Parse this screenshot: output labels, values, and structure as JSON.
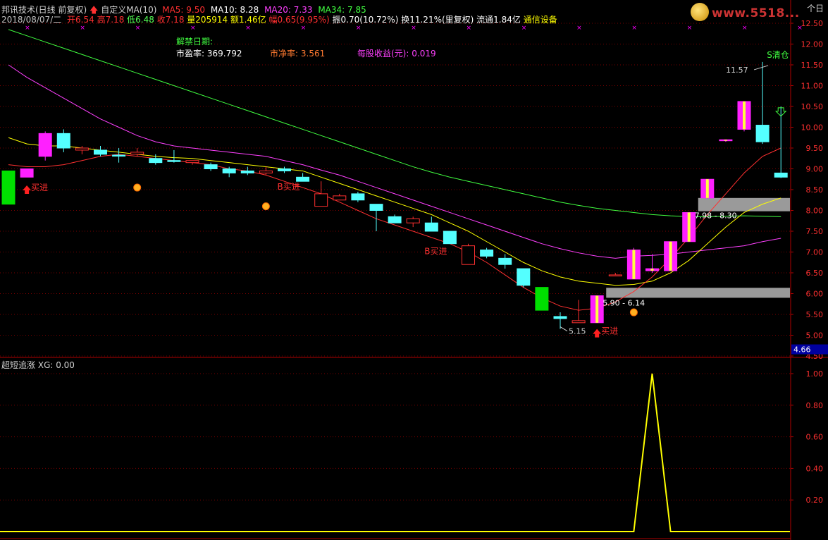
{
  "header": {
    "title": "邦讯技术(日线 前复权)",
    "custom_label": "自定义MA(10)",
    "ma5": "MA5: 9.50",
    "ma10": "MA10: 8.28",
    "ma20": "MA20: 7.33",
    "ma34": "MA34: 7.85",
    "date": "2018/08/07/二",
    "open": "开6.54",
    "high": "高7.18",
    "low": "低6.48",
    "close": "收7.18",
    "volume": "量205914",
    "amount": "额1.46亿",
    "change": "幅0.65(9.95%)",
    "amplitude": "振0.70(10.72%)",
    "turnover": "换11.21%(里复权)",
    "float_cap": "流通1.84亿",
    "industry": "通信设备"
  },
  "info": {
    "unlock": "解禁日期:",
    "pe_label": "市盈率:",
    "pe_value": "369.792",
    "pb_label": "市净率:",
    "pb_value": "3.561",
    "eps_label": "每股收益(元):",
    "eps_value": "0.019"
  },
  "logo": {
    "text": "www.5518...",
    "corner": "个日"
  },
  "indicator": {
    "title": "超短追涨",
    "xg": "XG: 0.00"
  },
  "colors": {
    "bg": "#000000",
    "grid": "#7a0000",
    "up": "#ff3030",
    "down": "#54ffff",
    "ma5": "#ffffff",
    "ma10": "#ff3030",
    "ma20": "#ff40ff",
    "ma34": "#40ff40",
    "yellow": "#ffff00",
    "signal": "#ff00ff"
  },
  "chart_data": {
    "type": "candlestick",
    "y_axis": {
      "min": 4.5,
      "max": 12.5,
      "ticks": [
        4.5,
        5.0,
        5.5,
        6.0,
        6.5,
        7.0,
        7.5,
        8.0,
        8.5,
        9.0,
        9.5,
        10.0,
        10.5,
        11.0,
        11.5,
        12.0,
        12.5
      ]
    },
    "last_price_label": "4.66",
    "candles": [
      {
        "o": 8.15,
        "h": 8.95,
        "l": 8.15,
        "c": 8.95,
        "color": "green"
      },
      {
        "o": 8.8,
        "h": 9.0,
        "l": 8.8,
        "c": 9.0,
        "color": "magenta"
      },
      {
        "o": 9.3,
        "h": 9.9,
        "l": 9.2,
        "c": 9.85,
        "color": "magenta"
      },
      {
        "o": 9.85,
        "h": 9.95,
        "l": 9.4,
        "c": 9.5,
        "color": "cyan"
      },
      {
        "o": 9.45,
        "h": 9.55,
        "l": 9.35,
        "c": 9.5,
        "color": "up"
      },
      {
        "o": 9.45,
        "h": 9.55,
        "l": 9.3,
        "c": 9.35,
        "color": "cyan"
      },
      {
        "o": 9.32,
        "h": 9.5,
        "l": 9.15,
        "c": 9.33,
        "color": "cyan"
      },
      {
        "o": 9.35,
        "h": 9.5,
        "l": 9.3,
        "c": 9.4,
        "color": "up"
      },
      {
        "o": 9.25,
        "h": 9.35,
        "l": 9.1,
        "c": 9.15,
        "color": "cyan"
      },
      {
        "o": 9.2,
        "h": 9.45,
        "l": 9.15,
        "c": 9.2,
        "color": "cyan"
      },
      {
        "o": 9.15,
        "h": 9.2,
        "l": 9.1,
        "c": 9.2,
        "color": "up"
      },
      {
        "o": 9.1,
        "h": 9.15,
        "l": 8.95,
        "c": 9.0,
        "color": "cyan"
      },
      {
        "o": 9.0,
        "h": 9.05,
        "l": 8.8,
        "c": 8.9,
        "color": "cyan"
      },
      {
        "o": 8.95,
        "h": 9.05,
        "l": 8.85,
        "c": 8.9,
        "color": "cyan"
      },
      {
        "o": 8.9,
        "h": 9.05,
        "l": 8.85,
        "c": 8.95,
        "color": "up"
      },
      {
        "o": 9.0,
        "h": 9.05,
        "l": 8.9,
        "c": 8.95,
        "color": "cyan"
      },
      {
        "o": 8.8,
        "h": 8.9,
        "l": 8.7,
        "c": 8.7,
        "color": "cyan"
      },
      {
        "o": 8.1,
        "h": 8.7,
        "l": 8.1,
        "c": 8.4,
        "color": "up"
      },
      {
        "o": 8.25,
        "h": 8.4,
        "l": 8.25,
        "c": 8.35,
        "color": "up"
      },
      {
        "o": 8.4,
        "h": 8.45,
        "l": 8.2,
        "c": 8.25,
        "color": "cyan"
      },
      {
        "o": 8.15,
        "h": 8.15,
        "l": 7.5,
        "c": 8.0,
        "color": "cyan"
      },
      {
        "o": 7.85,
        "h": 7.9,
        "l": 7.7,
        "c": 7.7,
        "color": "cyan"
      },
      {
        "o": 7.7,
        "h": 7.85,
        "l": 7.6,
        "c": 7.8,
        "color": "up"
      },
      {
        "o": 7.7,
        "h": 7.85,
        "l": 7.5,
        "c": 7.5,
        "color": "cyan"
      },
      {
        "o": 7.5,
        "h": 7.5,
        "l": 7.2,
        "c": 7.2,
        "color": "cyan"
      },
      {
        "o": 6.7,
        "h": 7.2,
        "l": 6.7,
        "c": 7.15,
        "color": "up"
      },
      {
        "o": 7.05,
        "h": 7.1,
        "l": 6.85,
        "c": 6.9,
        "color": "cyan"
      },
      {
        "o": 6.85,
        "h": 6.95,
        "l": 6.6,
        "c": 6.7,
        "color": "cyan"
      },
      {
        "o": 6.6,
        "h": 6.6,
        "l": 6.15,
        "c": 6.2,
        "color": "cyan"
      },
      {
        "o": 5.6,
        "h": 6.15,
        "l": 5.6,
        "c": 6.15,
        "color": "green"
      },
      {
        "o": 5.45,
        "h": 5.55,
        "l": 5.15,
        "c": 5.4,
        "color": "cyan"
      },
      {
        "o": 5.3,
        "h": 5.85,
        "l": 5.3,
        "c": 5.35,
        "color": "up"
      },
      {
        "o": 5.3,
        "h": 5.95,
        "l": 5.3,
        "c": 5.95,
        "color": "magenta"
      },
      {
        "o": 6.45,
        "h": 6.5,
        "l": 6.45,
        "c": 6.45,
        "color": "up"
      },
      {
        "o": 6.35,
        "h": 7.1,
        "l": 6.35,
        "c": 7.05,
        "color": "magenta"
      },
      {
        "o": 6.55,
        "h": 6.95,
        "l": 6.5,
        "c": 6.6,
        "color": "magenta"
      },
      {
        "o": 6.55,
        "h": 7.25,
        "l": 6.55,
        "c": 7.25,
        "color": "magenta"
      },
      {
        "o": 7.25,
        "h": 7.95,
        "l": 7.25,
        "c": 7.95,
        "color": "magenta"
      },
      {
        "o": 8.3,
        "h": 8.75,
        "l": 8.3,
        "c": 8.75,
        "color": "magenta"
      },
      {
        "o": 9.7,
        "h": 9.7,
        "l": 9.65,
        "c": 9.7,
        "color": "magenta"
      },
      {
        "o": 9.95,
        "h": 10.62,
        "l": 9.9,
        "c": 10.62,
        "color": "magenta"
      },
      {
        "o": 10.05,
        "h": 11.57,
        "l": 9.6,
        "c": 9.65,
        "color": "cyan"
      },
      {
        "o": 8.9,
        "h": 10.5,
        "l": 8.78,
        "c": 8.8,
        "color": "cyan"
      }
    ],
    "ma_lines": {
      "ma_yellow": [
        9.75,
        9.6,
        9.55,
        9.55,
        9.5,
        9.45,
        9.4,
        9.35,
        9.3,
        9.27,
        9.25,
        9.2,
        9.15,
        9.1,
        9.05,
        9.0,
        8.95,
        8.8,
        8.65,
        8.5,
        8.35,
        8.2,
        8.05,
        7.9,
        7.7,
        7.5,
        7.25,
        7.0,
        6.75,
        6.55,
        6.4,
        6.3,
        6.25,
        6.2,
        6.22,
        6.3,
        6.5,
        6.8,
        7.2,
        7.6,
        7.95,
        8.15,
        8.3
      ],
      "ma_red": [
        9.1,
        9.05,
        9.05,
        9.1,
        9.2,
        9.3,
        9.35,
        9.3,
        9.25,
        9.2,
        9.15,
        9.1,
        9.0,
        8.95,
        8.85,
        8.7,
        8.55,
        8.4,
        8.2,
        8.0,
        7.8,
        7.65,
        7.5,
        7.35,
        7.2,
        7.0,
        6.75,
        6.45,
        6.15,
        5.9,
        5.7,
        5.6,
        5.65,
        5.8,
        6.05,
        6.4,
        6.85,
        7.35,
        7.9,
        8.4,
        8.9,
        9.3,
        9.5
      ],
      "ma20": [
        11.5,
        11.2,
        10.95,
        10.7,
        10.45,
        10.2,
        10.0,
        9.8,
        9.65,
        9.55,
        9.5,
        9.45,
        9.4,
        9.35,
        9.3,
        9.2,
        9.1,
        8.97,
        8.85,
        8.7,
        8.55,
        8.4,
        8.25,
        8.1,
        7.95,
        7.8,
        7.65,
        7.5,
        7.35,
        7.2,
        7.08,
        6.98,
        6.9,
        6.85,
        6.9,
        6.92,
        6.95,
        7.0,
        7.05,
        7.1,
        7.15,
        7.25,
        7.33
      ],
      "ma34": [
        12.35,
        12.2,
        12.05,
        11.9,
        11.75,
        11.6,
        11.45,
        11.3,
        11.15,
        11.0,
        10.85,
        10.7,
        10.55,
        10.4,
        10.25,
        10.1,
        9.95,
        9.8,
        9.65,
        9.5,
        9.35,
        9.2,
        9.05,
        8.92,
        8.8,
        8.7,
        8.6,
        8.5,
        8.4,
        8.3,
        8.2,
        8.12,
        8.05,
        8.0,
        7.95,
        7.9,
        7.87,
        7.85,
        7.85,
        7.86,
        7.87,
        7.86,
        7.85
      ]
    },
    "annotations": [
      {
        "text": "买进",
        "candle": 1,
        "price": 8.55,
        "kind": "buy"
      },
      {
        "text": "B买进",
        "candle": 15,
        "price": 8.7,
        "kind": "B"
      },
      {
        "text": "B买进",
        "candle": 23,
        "price": 7.15,
        "kind": "B"
      },
      {
        "text": "买进",
        "candle": 32,
        "price": 5.1,
        "kind": "buy"
      },
      {
        "text": "5.15",
        "candle": 30,
        "price": 5.1,
        "kind": "low"
      },
      {
        "text": "11.57",
        "candle": 41,
        "price": 11.45,
        "kind": "high"
      },
      {
        "text": "S清仓",
        "candle": 42,
        "price": 11.7,
        "kind": "sell"
      },
      {
        "text": "5.90 - 6.14",
        "candle": 32,
        "price": 5.78,
        "kind": "zone"
      },
      {
        "text": "7.98 - 8.30",
        "candle": 37,
        "price": 7.88,
        "kind": "zone"
      }
    ],
    "zones": [
      {
        "from_candle": 32.5,
        "lo": 5.9,
        "hi": 6.14
      },
      {
        "from_candle": 37.5,
        "lo": 7.98,
        "hi": 8.3
      }
    ],
    "indicator": {
      "name": "XG",
      "y_axis": {
        "min": 0,
        "max": 1.0,
        "ticks": [
          0.2,
          0.4,
          0.6,
          0.8,
          1.0
        ]
      },
      "values": [
        0,
        0,
        0,
        0,
        0,
        0,
        0,
        0,
        0,
        0,
        0,
        0,
        0,
        0,
        0,
        0,
        0,
        0,
        0,
        0,
        0,
        0,
        0,
        0,
        0,
        0,
        0,
        0,
        0,
        0,
        0,
        0,
        0,
        0,
        0,
        0,
        1,
        0,
        0,
        0,
        0,
        0,
        0
      ]
    }
  }
}
